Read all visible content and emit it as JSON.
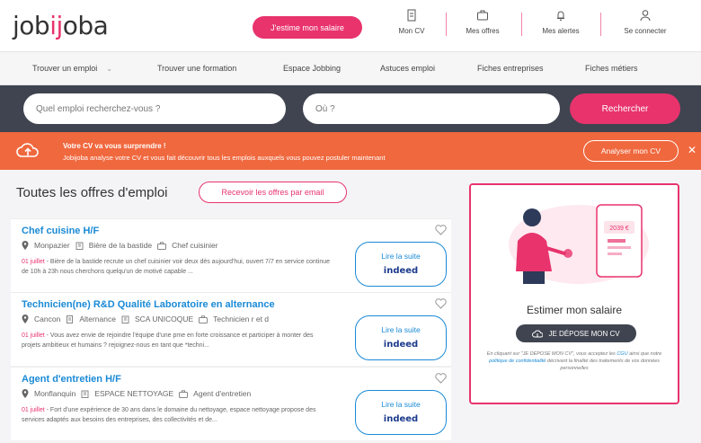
{
  "header": {
    "logo_prefix": "job",
    "logo_mid": "ij",
    "logo_suffix": "oba",
    "salary_cta": "J'estime mon salaire",
    "nav": [
      {
        "label": "Mon CV",
        "icon": "document-icon"
      },
      {
        "label": "Mes offres",
        "icon": "briefcase-icon"
      },
      {
        "label": "Mes alertes",
        "icon": "bell-icon"
      },
      {
        "label": "Se connecter",
        "icon": "user-icon"
      }
    ]
  },
  "menu": {
    "items": [
      "Trouver un emploi",
      "Trouver une formation",
      "Espace Jobbing",
      "Astuces emploi",
      "Fiches entreprises",
      "Fiches métiers"
    ]
  },
  "search": {
    "what_placeholder": "Quel emploi recherchez-vous ?",
    "where_placeholder": "Où ?",
    "button": "Rechercher"
  },
  "banner": {
    "title": "Votre CV va vous surprendre !",
    "text": "Jobijoba analyse votre CV et vous fait découvrir tous les emplois auxquels vous pouvez postuler maintenant",
    "button": "Analyser mon CV",
    "close": "✕"
  },
  "main": {
    "title": "Toutes les offres d'emploi",
    "receive_button": "Recevoir les offres par email",
    "read_label": "Lire la suite",
    "source": "indeed",
    "jobs": [
      {
        "title": "Chef cuisine H/F",
        "location": "Monpazier",
        "company": "Bière de la bastide",
        "category": "Chef cuisinier",
        "date": "01 juillet",
        "description": "Bière de la bastide recrute un chef cuisinier voir deux dès aujourd'hui, ouvert 7/7 en service continue de 10h à 23h nous cherchons quelqu'un de motivé capable ..."
      },
      {
        "title": "Technicien(ne) R&D Qualité Laboratoire en alternance",
        "location": "Cancon",
        "contract": "Alternance",
        "company": "SCA UNICOQUE",
        "category": "Technicien r et d",
        "date": "01 juillet",
        "description": "Vous avez envie de rejoindre l'équipe d'une pme en forte croissance et participer à monter des projets ambitieux et humains ? rejoignez-nous en tant que *techni..."
      },
      {
        "title": "Agent d'entretien H/F",
        "location": "Monflanquin",
        "company": "ESPACE NETTOYAGE",
        "category": "Agent d'entretien",
        "date": "01 juillet",
        "description": "Fort d'une expérience de 30 ans dans le domaine du nettoyage, espace nettoyage propose des services adaptés aux besoins des entreprises, des collectivités et de..."
      }
    ]
  },
  "widget": {
    "amount": "2039 €",
    "title": "Estimer mon salaire",
    "button": "JE DÉPOSE MON CV",
    "legal_a": "En cliquant sur \"JE DÉPOSE MON CV\", vous acceptez les",
    "legal_cgu": "CGU",
    "legal_b": "ainsi que notre",
    "legal_policy": "politique de confidentialité",
    "legal_c": "décrivant la finalité des traitements de vos données personnelles"
  },
  "colors": {
    "brand_pink": "#e8336d",
    "banner_orange": "#f0683e",
    "search_band": "#3f4450",
    "link_blue": "#1a8ad6"
  }
}
